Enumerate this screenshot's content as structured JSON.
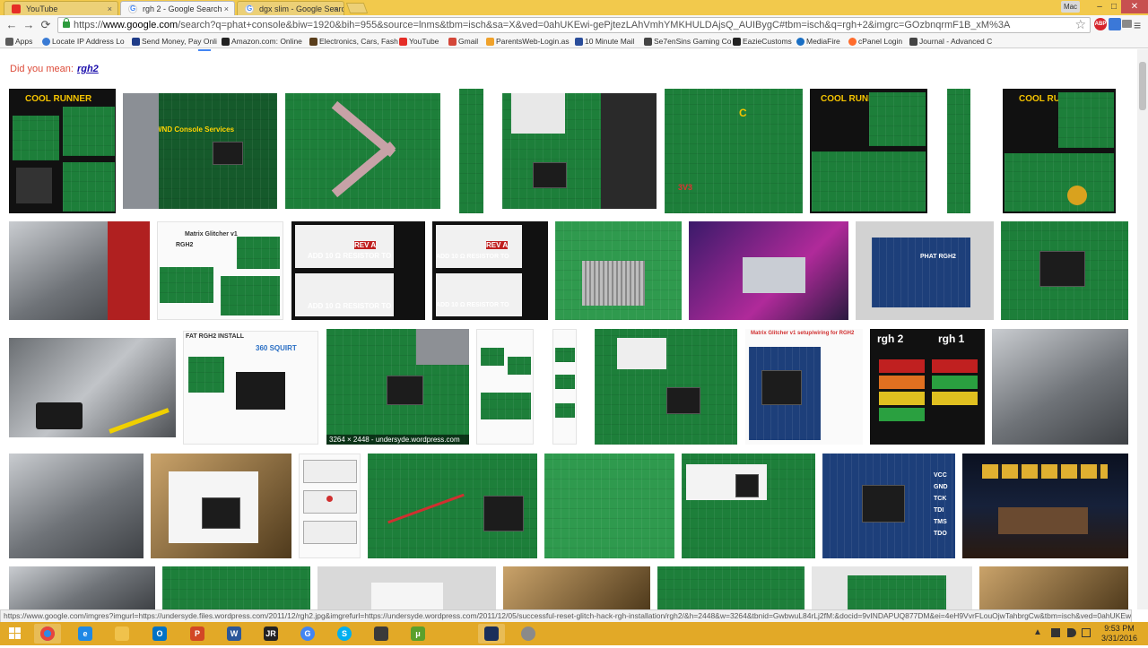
{
  "tabs": [
    {
      "title": "YouTube",
      "favicon": "youtube-icon",
      "state": "inactive"
    },
    {
      "title": "rgh 2 - Google Search",
      "favicon": "google-icon",
      "state": "active"
    },
    {
      "title": "dgx slim - Google Search",
      "favicon": "google-icon",
      "state": "inactive"
    }
  ],
  "tab_close_glyph": "×",
  "profile_label": "Mac",
  "window": {
    "minimize": "–",
    "maximize": "□",
    "close": "✕"
  },
  "nav": {
    "back": "←",
    "forward": "→",
    "reload": "⟳"
  },
  "omnibox": {
    "scheme": "https://",
    "host": "www.google.com",
    "path": "/search?q=phat+console&biw=1920&bih=955&source=lnms&tbm=isch&sa=X&ved=0ahUKEwi-gePjtezLAhVmhYMKHULDAjsQ_AUIBygC#tbm=isch&q=rgh+2&imgrc=GOzbnqrmF1B_xM%3A",
    "star": "☆"
  },
  "extensions": [
    {
      "name": "adblock-plus-icon",
      "label": "ABP",
      "color": "#d6242c"
    },
    {
      "name": "extension-icon",
      "label": "",
      "color": "#3b78d8"
    },
    {
      "name": "cast-icon",
      "label": "",
      "color": "#6d6d6d"
    }
  ],
  "menu_glyph": "≡",
  "bookmarks": [
    {
      "label": "Apps",
      "icon": "apps-grid-icon",
      "color": "#5b5b5b"
    },
    {
      "label": "Locate IP Address Lo",
      "icon": "globe-icon",
      "color": "#3a7bd5"
    },
    {
      "label": "Send Money, Pay Onli",
      "icon": "paypal-icon",
      "color": "#1f3c88"
    },
    {
      "label": "Amazon.com: Online",
      "icon": "amazon-icon",
      "color": "#222"
    },
    {
      "label": "Electronics, Cars, Fash",
      "icon": "ebay-icon",
      "color": "#5a3e1b"
    },
    {
      "label": "YouTube",
      "icon": "youtube-icon",
      "color": "#e52d27"
    },
    {
      "label": "Gmail",
      "icon": "gmail-icon",
      "color": "#d44638"
    },
    {
      "label": "ParentsWeb-Login.as",
      "icon": "page-icon",
      "color": "#f0a22b"
    },
    {
      "label": "10 Minute Mail",
      "icon": "mail-icon",
      "color": "#2a4d9b"
    },
    {
      "label": "Se7enSins Gaming Co",
      "icon": "forum-icon",
      "color": "#444"
    },
    {
      "label": "EazieCustoms",
      "icon": "shop-icon",
      "color": "#222"
    },
    {
      "label": "MediaFire",
      "icon": "mediafire-icon",
      "color": "#1a6fc4"
    },
    {
      "label": "cPanel Login",
      "icon": "cpanel-icon",
      "color": "#ff6c2c"
    },
    {
      "label": "Journal - Advanced C",
      "icon": "journal-icon",
      "color": "#444"
    }
  ],
  "did_you_mean": {
    "prefix": "Did you mean:",
    "suggestion": "rgh2"
  },
  "image_texts": {
    "cool_runner": "COOL RUNNER",
    "wnd_console": "WND Console Services",
    "matrix_glitcher": "Matrix Glitcher v1",
    "rgh2": "RGH2",
    "add_resistor": "ADD 10 Ω RESISTOR TO",
    "rev_a": "REV A",
    "phat_rgh2": "PHAT RGH2",
    "fat_rgh2_install": "FAT RGH2 INSTALL",
    "squirt": "360 SQUIRT",
    "matrix_wiring": "Matrix Glitcher v1 setup/wiring for RGH2",
    "rgh_2": "rgh 2",
    "rgh_1": "rgh 1",
    "dims_label": "3264 × 2448 - undersyde.wordpress.com",
    "pins": "VCC GND TCK TDI TMS TDO"
  },
  "status_url": "https://www.google.com/imgres?imgurl=https://undersyde.files.wordpress.com/2011/12/rgh2.jpg&imgrefurl=https://undersyde.wordpress.com/2011/12/05/successful-reset-glitch-hack-rgh-installation/rgh2/&h=2448&w=3264&tbnid=GwbwuL84rLj2fM:&docid=9vINDAPUQ877DM&ei=4eH9VvrFLouOjwTahbrgCw&tbm=isch&ved=0ahUKEwi6ubz_tuzLA...",
  "taskbar_apps": [
    {
      "name": "chrome",
      "label": "",
      "color": "#2f8ae5"
    },
    {
      "name": "internet-explorer",
      "label": "e",
      "color": "#1e88e5"
    },
    {
      "name": "file-explorer",
      "label": "",
      "color": "#f0c24c"
    },
    {
      "name": "outlook",
      "label": "O",
      "color": "#0072c6"
    },
    {
      "name": "powerpoint",
      "label": "P",
      "color": "#d24726"
    },
    {
      "name": "word",
      "label": "W",
      "color": "#2b579a"
    },
    {
      "name": "jr-app",
      "label": "JR",
      "color": "#222"
    },
    {
      "name": "google-app",
      "label": "G",
      "color": "#4285f4"
    },
    {
      "name": "skype",
      "label": "S",
      "color": "#00aff0"
    },
    {
      "name": "calculator",
      "label": "",
      "color": "#3a3a3a"
    },
    {
      "name": "utorrent",
      "label": "μ",
      "color": "#5aa02c"
    },
    {
      "name": "media-app",
      "label": "",
      "color": "#1a2f5a"
    },
    {
      "name": "steam-app",
      "label": "",
      "color": "#8a8a8a"
    }
  ],
  "clock": {
    "time": "9:53 PM",
    "date": "3/31/2016"
  }
}
